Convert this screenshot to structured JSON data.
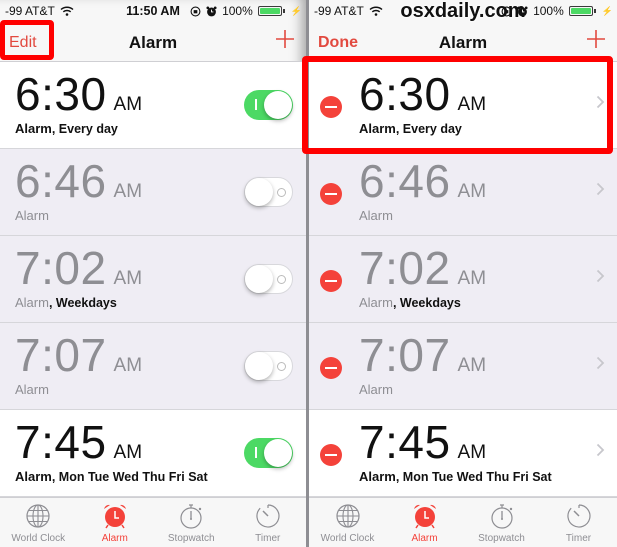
{
  "colors": {
    "accent": "#f4423a",
    "toggle_on": "#4cd964",
    "highlight": "#ff0000",
    "disabled_text": "#8e8e93"
  },
  "status_bar": {
    "carrier": "-99 AT&T",
    "time": "11:50 AM",
    "battery": "100%",
    "icons": [
      "wifi-icon",
      "rotation-lock-icon",
      "alarm-clock-icon",
      "battery-icon",
      "charging-bolt-icon"
    ]
  },
  "watermark": "osxdaily.com",
  "left_panel": {
    "nav": {
      "left_button": "Edit",
      "title": "Alarm",
      "right_icon": "plus-icon"
    }
  },
  "right_panel": {
    "nav": {
      "left_button": "Done",
      "title": "Alarm",
      "right_icon": "plus-icon"
    }
  },
  "alarms": [
    {
      "time": "6:30",
      "ampm": "AM",
      "label": "Alarm",
      "repeat": ", Every day",
      "enabled": true
    },
    {
      "time": "6:46",
      "ampm": "AM",
      "label": "Alarm",
      "repeat": "",
      "enabled": false
    },
    {
      "time": "7:02",
      "ampm": "AM",
      "label": "Alarm",
      "repeat": ", Weekdays",
      "enabled": false
    },
    {
      "time": "7:07",
      "ampm": "AM",
      "label": "Alarm",
      "repeat": "",
      "enabled": false
    },
    {
      "time": "7:45",
      "ampm": "AM",
      "label": "Alarm",
      "repeat": ", Mon Tue Wed Thu Fri Sat",
      "enabled": true
    }
  ],
  "tabs": [
    {
      "label": "World Clock",
      "icon": "globe-icon",
      "active": false
    },
    {
      "label": "Alarm",
      "icon": "alarm-clock-icon",
      "active": true
    },
    {
      "label": "Stopwatch",
      "icon": "stopwatch-icon",
      "active": false
    },
    {
      "label": "Timer",
      "icon": "timer-icon",
      "active": false
    }
  ]
}
